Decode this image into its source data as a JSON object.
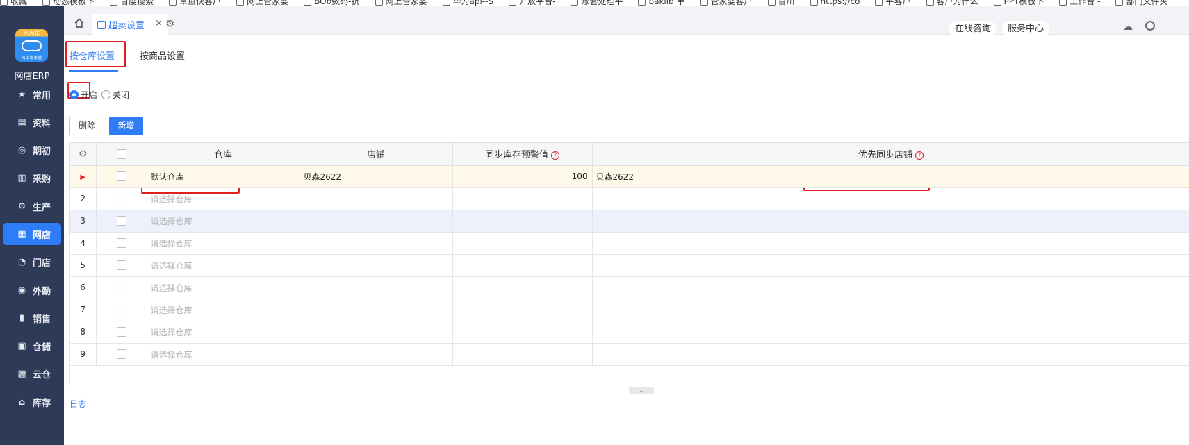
{
  "bookmarks": [
    "收藏",
    "动态模板下",
    "百度搜索",
    "草鱼快客户",
    "网上管家婆",
    "BOb数码-抗",
    "网上管家婆",
    "华为api--S",
    "开放平台-",
    "账套处理平",
    "baklib 单",
    "管家婆客户",
    "百川",
    "https://co",
    "平客户",
    "客户为什么",
    "PPT模板下",
    "工作台 -",
    "部门文件夹"
  ],
  "sidebar": {
    "logo_badge": "八周年",
    "logo_text": "网上管家婆",
    "app_name": "网店ERP",
    "items": [
      {
        "label": "常用",
        "icon": "★"
      },
      {
        "label": "资料",
        "icon": "▤"
      },
      {
        "label": "期初",
        "icon": "◎"
      },
      {
        "label": "采购",
        "icon": "▥"
      },
      {
        "label": "生产",
        "icon": "⚙"
      },
      {
        "label": "网店",
        "icon": "▦"
      },
      {
        "label": "门店",
        "icon": "◔"
      },
      {
        "label": "外勤",
        "icon": "◉"
      },
      {
        "label": "销售",
        "icon": "▮"
      },
      {
        "label": "仓储",
        "icon": "▣"
      },
      {
        "label": "云仓",
        "icon": "▩"
      },
      {
        "label": "库存",
        "icon": "⌂"
      }
    ]
  },
  "tabbar": {
    "home_icon": "home-icon",
    "active_tab": "超卖设置",
    "close": "×",
    "online_consult": "在线咨询",
    "service_center": "服务中心"
  },
  "settings_tabs": {
    "by_warehouse": "按仓库设置",
    "by_product": "按商品设置"
  },
  "switch": {
    "on_label": "开启",
    "off_label": "关闭",
    "selected": "开启"
  },
  "buttons": {
    "delete": "删除",
    "add": "新增"
  },
  "grid": {
    "columns": {
      "warehouse": "仓库",
      "shop": "店铺",
      "threshold": "同步库存预警值",
      "priority_shop": "优先同步店铺"
    },
    "help_mark": "?",
    "first_row": {
      "marker": "▶",
      "warehouse": "默认仓库",
      "shop": "贝森2622",
      "threshold": "100",
      "priority_shop": "贝森2622"
    },
    "placeholder": "请选择仓库",
    "row_numbers": [
      "2",
      "3",
      "4",
      "5",
      "6",
      "7",
      "8",
      "9"
    ]
  },
  "splitter": "⌄",
  "footer": {
    "log_link": "日志"
  }
}
